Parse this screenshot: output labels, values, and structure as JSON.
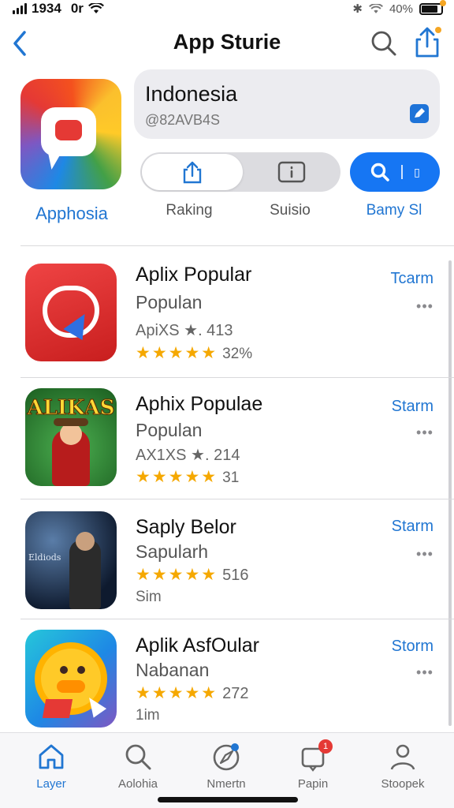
{
  "status_bar": {
    "time": "1934",
    "carrier": "0r",
    "battery": "40%"
  },
  "nav": {
    "title": "App Sturie"
  },
  "header": {
    "app_name": "Apphosia",
    "card_title": "Indonesia",
    "card_subtitle": "@82AVB4S",
    "buttons": {
      "ranking_label": "Raking",
      "subscribe_label": "Suisio",
      "primary_label": "Bamy Sl"
    }
  },
  "apps": [
    {
      "title": "Aplix Popular",
      "subtitle": "Populan",
      "line3": "ApiXS ★. 413",
      "stars": "★★★★★",
      "rating_count": "32%",
      "action": "Tcarm",
      "more": "•••"
    },
    {
      "title": "Aphix Populae",
      "subtitle": "Populan",
      "line3": "AX1XS ★. 214",
      "stars": "★★★★★",
      "rating_count": "31",
      "action": "Starm",
      "more": "•••",
      "icon_text": "ALIKAS"
    },
    {
      "title": "Saply Belor",
      "subtitle": "Sapularh",
      "stars": "★★★★★",
      "rating_count": "516",
      "line4": "Sim",
      "action": "Starm",
      "more": "•••",
      "icon_text": "Eldiods"
    },
    {
      "title": "Aplik AsfOular",
      "subtitle": "Nabanan",
      "stars": "★★★★★",
      "rating_count": "272",
      "line4": "1im",
      "action": "Storm",
      "more": "•••"
    }
  ],
  "tabs": [
    {
      "label": "Layer",
      "icon": "home-icon",
      "active": true
    },
    {
      "label": "Aolohia",
      "icon": "search-icon"
    },
    {
      "label": "Nmertn",
      "icon": "compass-icon"
    },
    {
      "label": "Papin",
      "icon": "notification-icon",
      "badge": "1"
    },
    {
      "label": "Stoopek",
      "icon": "person-icon"
    }
  ],
  "colors": {
    "accent": "#2176d2",
    "primary_button": "#1676f3",
    "star": "#f5a800",
    "badge": "#e53935"
  }
}
